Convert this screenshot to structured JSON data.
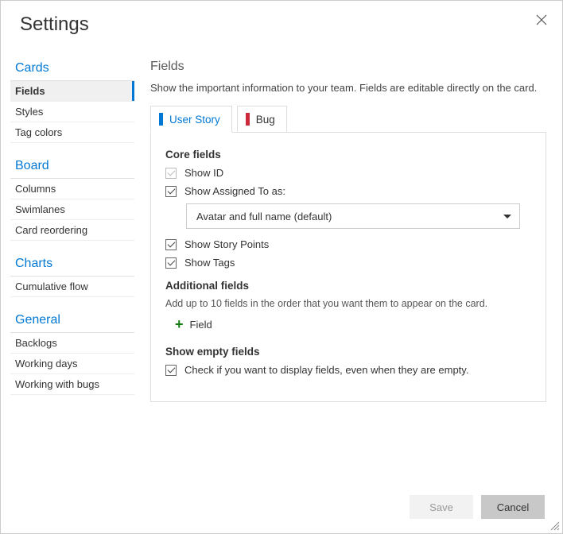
{
  "dialog": {
    "title": "Settings"
  },
  "sidebar": {
    "sections": [
      {
        "header": "Cards",
        "items": [
          {
            "label": "Fields",
            "active": true
          },
          {
            "label": "Styles"
          },
          {
            "label": "Tag colors"
          }
        ]
      },
      {
        "header": "Board",
        "items": [
          {
            "label": "Columns"
          },
          {
            "label": "Swimlanes"
          },
          {
            "label": "Card reordering"
          }
        ]
      },
      {
        "header": "Charts",
        "items": [
          {
            "label": "Cumulative flow"
          }
        ]
      },
      {
        "header": "General",
        "items": [
          {
            "label": "Backlogs"
          },
          {
            "label": "Working days"
          },
          {
            "label": "Working with bugs"
          }
        ]
      }
    ]
  },
  "main": {
    "title": "Fields",
    "description": "Show the important information to your team. Fields are editable directly on the card.",
    "tabs": [
      {
        "label": "User Story",
        "color": "blue",
        "active": true
      },
      {
        "label": "Bug",
        "color": "red"
      }
    ],
    "core": {
      "heading": "Core fields",
      "show_id": {
        "label": "Show ID",
        "checked": true,
        "dim": true
      },
      "show_assigned": {
        "label": "Show Assigned To as:",
        "checked": true
      },
      "assigned_dropdown": {
        "value": "Avatar and full name (default)"
      },
      "show_points": {
        "label": "Show Story Points",
        "checked": true
      },
      "show_tags": {
        "label": "Show Tags",
        "checked": true
      }
    },
    "additional": {
      "heading": "Additional fields",
      "subtext": "Add up to 10 fields in the order that you want them to appear on the card.",
      "add_label": "Field"
    },
    "empty": {
      "heading": "Show empty fields",
      "checkbox": {
        "label": "Check if you want to display fields, even when they are empty.",
        "checked": true
      }
    }
  },
  "footer": {
    "save": "Save",
    "cancel": "Cancel"
  }
}
